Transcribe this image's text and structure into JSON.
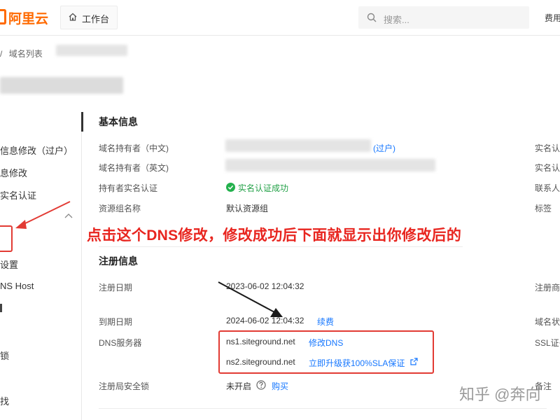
{
  "header": {
    "logo": "阿里云",
    "workbench_label": "工作台",
    "search_placeholder": "搜索...",
    "fee_label": "费用"
  },
  "breadcrumb": {
    "separator": "/",
    "current": "域名列表"
  },
  "left_menu": {
    "items": [
      "信息修改（过户）",
      "息修改",
      "实名认证",
      "设置",
      "NS Host",
      "锁",
      "找"
    ]
  },
  "basic_info": {
    "title": "基本信息",
    "rows": [
      {
        "label": "域名持有者（中文)",
        "link": "(过户)"
      },
      {
        "label": "域名持有者（英文)"
      },
      {
        "label": "持有者实名认证",
        "status": "实名认证成功"
      },
      {
        "label": "资源组名称",
        "value": "默认资源组"
      }
    ],
    "right_labels": [
      "实名认",
      "实名认",
      "联系人",
      "标签"
    ]
  },
  "annotation": {
    "text": "点击这个DNS修改，修改成功后下面就显示出你修改后的",
    "colors": {
      "accent": "#e8251f"
    }
  },
  "registration_info": {
    "title": "注册信息",
    "reg_date_label": "注册日期",
    "reg_date_value": "2023-06-02 12:04:32",
    "exp_date_label": "到期日期",
    "exp_date_value": "2024-06-02 12:04:32",
    "renew_link": "续费",
    "dns_label": "DNS服务器",
    "ns1": "ns1.siteground.net",
    "modify_dns_link": "修改DNS",
    "ns2": "ns2.siteground.net",
    "upgrade_link": "立即升级获100%SLA保证",
    "lock_label": "注册局安全锁",
    "lock_value": "未开启",
    "buy_link": "购买",
    "right_labels": [
      "注册商",
      "域名状",
      "SSL证书",
      "备注"
    ]
  },
  "watermark": "知乎 @奔向"
}
